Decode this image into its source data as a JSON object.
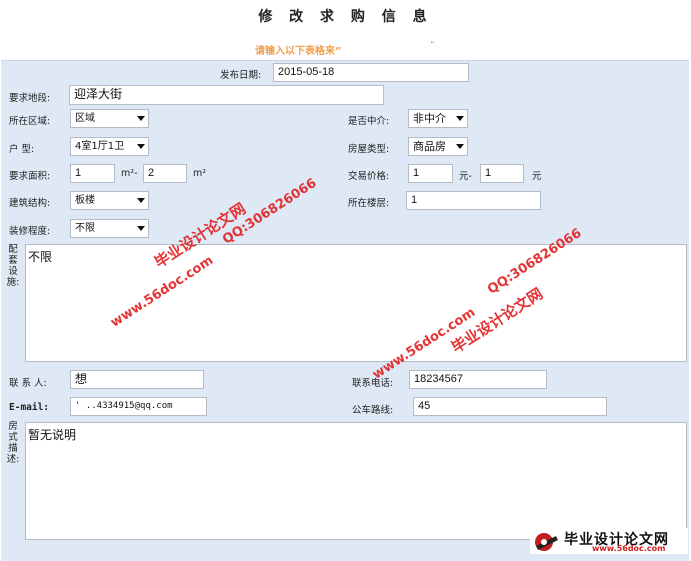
{
  "page": {
    "title": "修 改 求 购 信 息",
    "subtitle": "请输入以下表格来”",
    "subtitle_mark": "\""
  },
  "form": {
    "publish_date": {
      "label": "发布日期:",
      "value": "2015-05-18"
    },
    "area_section": {
      "label": "要求地段:",
      "value": "迎泽大街"
    },
    "region": {
      "label": "所在区域:",
      "value": "区域"
    },
    "agency": {
      "label": "是否中介:",
      "value": "非中介"
    },
    "layout": {
      "label": "户    型:",
      "value": "4室1厅1卫"
    },
    "house_type": {
      "label": "房屋类型:",
      "value": "商品房"
    },
    "size": {
      "label": "要求面积:",
      "min": "1",
      "sep": "m²-",
      "max": "2",
      "unit": "m²"
    },
    "price": {
      "label": "交易价格:",
      "min": "1",
      "sep": "元-",
      "max": "1",
      "unit": "元"
    },
    "structure": {
      "label": "建筑结构:",
      "value": "板楼"
    },
    "floor": {
      "label": "所在楼层:",
      "value": "1"
    },
    "decoration": {
      "label": "装修程度:",
      "value": "不限"
    },
    "facilities": {
      "label": "配套设施:",
      "value": "不限"
    },
    "contact": {
      "label": "联 系 人:",
      "value": "想"
    },
    "phone": {
      "label": "联系电话:",
      "value": "18234567"
    },
    "email": {
      "label": "E-mail:",
      "value": "' ..4334915@qq.com"
    },
    "bus": {
      "label": "公车路线:",
      "value": "45"
    },
    "description": {
      "label": "房式描述:",
      "value": "暂无说明"
    }
  },
  "watermarks": {
    "site_name": "毕业设计论文网",
    "qq": "QQ:306826066",
    "url": "www.56doc.com"
  },
  "logo": {
    "text": "毕业设计论文网",
    "url": "www.56doc.com"
  },
  "colors": {
    "panel_bg": "#dfe9f6",
    "accent_orange": "#f0a050",
    "watermark_red": "#e02020"
  }
}
